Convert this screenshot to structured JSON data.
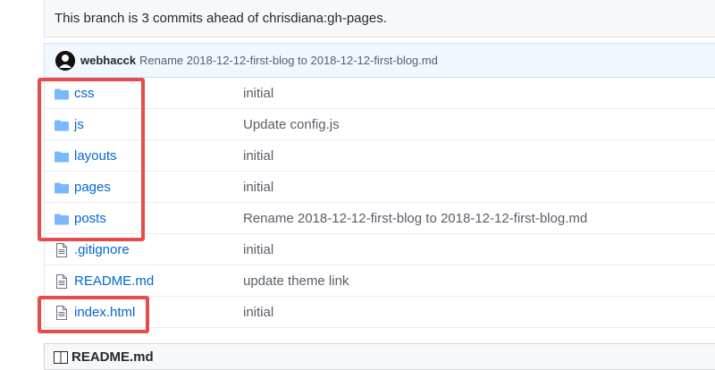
{
  "banner": {
    "text": "This branch is 3 commits ahead of chrisdiana:gh-pages."
  },
  "commit": {
    "author": "webhacck",
    "message": "Rename 2018-12-12-first-blog to 2018-12-12-first-blog.md"
  },
  "files": [
    {
      "name": "css",
      "type": "folder",
      "message": "initial"
    },
    {
      "name": "js",
      "type": "folder",
      "message": "Update config.js"
    },
    {
      "name": "layouts",
      "type": "folder",
      "message": "initial"
    },
    {
      "name": "pages",
      "type": "folder",
      "message": "initial"
    },
    {
      "name": "posts",
      "type": "folder",
      "message": "Rename 2018-12-12-first-blog to 2018-12-12-first-blog.md"
    },
    {
      "name": ".gitignore",
      "type": "file",
      "message": "initial"
    },
    {
      "name": "README.md",
      "type": "file",
      "message": "update theme link"
    },
    {
      "name": "index.html",
      "type": "file",
      "message": "initial"
    }
  ],
  "readme": {
    "title": "README.md"
  },
  "colors": {
    "link": "#0366d6",
    "folder_icon": "#79b8ff",
    "highlight": "#e74c4c"
  }
}
